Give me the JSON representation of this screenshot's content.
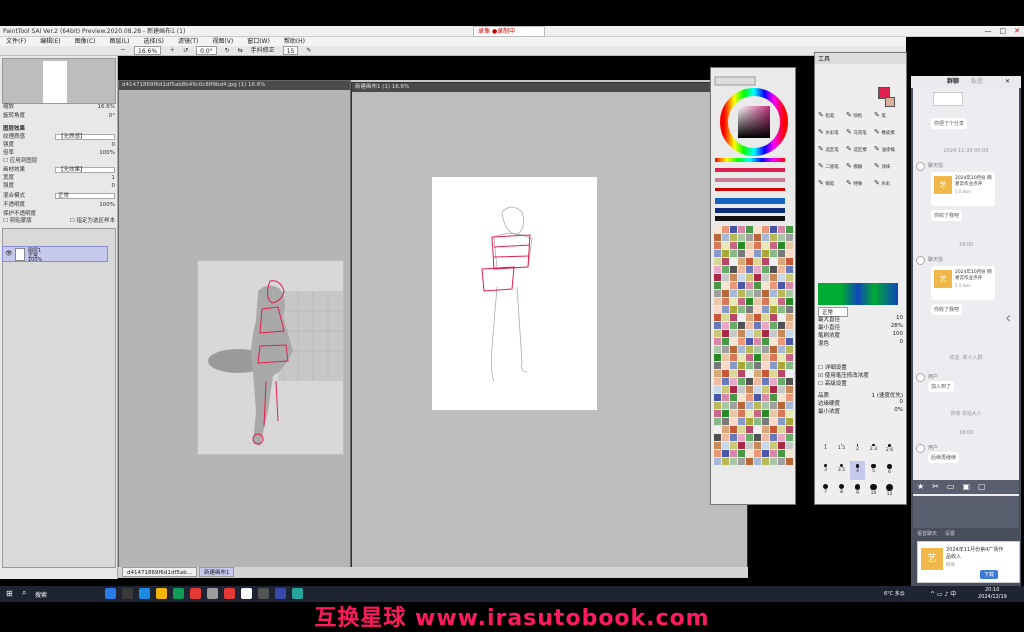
{
  "window": {
    "title": "PaintTool SAI Ver.2 (64bit) Preview.2020.08.28 - 新建画布1 (1)",
    "recording_label": "录像",
    "recording_time": "●录制中 00:09:12"
  },
  "menu": [
    "文件(F)",
    "编辑(E)",
    "图像(C)",
    "图层(L)",
    "选择(S)",
    "滤镜(T)",
    "视图(V)",
    "窗口(W)",
    "帮助(H)"
  ],
  "toolbar": {
    "zoom": "16.6%",
    "angle": "0.0°",
    "stabilizer_label": "手抖修正",
    "stabilizer": "15"
  },
  "left_panel": {
    "zoom_label": "缩放",
    "zoom_value": "16.6%",
    "angle_label": "旋转角度",
    "angle_value": "0°",
    "section_blend": "图层效果",
    "texture_label": "纹理质感",
    "texture_value": "【无质感】",
    "scale_label": "倍率",
    "scale_value": "100%",
    "strength_label": "强度",
    "strength_value": "0",
    "apply_checkbox": "应用到图层",
    "effect_label": "画材效果",
    "effect_value": "【无效果】",
    "width_label": "宽度",
    "width_value": "1",
    "strength2_label": "强度",
    "strength2_value": "0",
    "blend_label": "混合模式",
    "blend_value": "正常",
    "opacity_label": "不透明度",
    "opacity_value": "100%",
    "protect_label": "保护不透明度",
    "clip_label": "剪贴蒙版",
    "clip2_label": "指定为选区样本",
    "layer_name": "图层1",
    "layer_mode": "正常",
    "layer_opacity": "100%"
  },
  "documents": {
    "win1_title": "d41471869f6d1df5ab8b49c0c8ff9bd4.jpg (1) 16.6%",
    "win2_title": "新建画布1 (1) 16.6%",
    "tabs": [
      "d41471869f6d1df5ab...",
      "新建画布1"
    ]
  },
  "tool_panel": {
    "title": "工具",
    "brushes": [
      "铅笔",
      "喷枪",
      "笔",
      "水彩笔",
      "马克笔",
      "橡皮擦",
      "选区笔",
      "选区擦",
      "油漆桶",
      "二值笔",
      "模糊",
      "涂抹",
      "钢笔",
      "特殊",
      "水彩"
    ],
    "mode_label": "正常",
    "size_label": "最大直径",
    "size_value": "10",
    "min_label": "最小直径",
    "min_value": "28%",
    "density_label": "笔刷浓度",
    "density_value": "100",
    "blend_label": "混色",
    "blend_value": "0",
    "checkbox1": "详细设置",
    "checkbox2": "使用笔压修改浓度",
    "checkbox3": "高级设置",
    "quality_label": "品质",
    "quality_value": "1 (速度优先)",
    "edge_label": "边缘硬度",
    "edge_value": "0",
    "min_density": "最小浓度",
    "min_density_value": "0%",
    "brush_sizes": [
      "1",
      "1.5",
      "2",
      "2.3",
      "2.6",
      "3",
      "3.5",
      "4",
      "5",
      "6",
      "7",
      "8",
      "9",
      "10",
      "12"
    ]
  },
  "chat": {
    "tabs": [
      "群聊",
      "私信"
    ],
    "messages": [
      {
        "time": "",
        "sender": "",
        "text": "你把了个分享"
      },
      {
        "time": "2024-11-30 00:00",
        "sender": "聊天信",
        "card_title": "2024年10月份 网易云作业点评",
        "card_sub": "5.0.Ikon",
        "footer": "你收了我吧"
      },
      {
        "time": "18:00",
        "sender": "聊天信",
        "card_title": "2024年10月份 网易云作业点评",
        "card_sub": "5.0.Ikon",
        "footer": "你收了我吧"
      },
      {
        "time": "",
        "sender": "",
        "text": "欢迎, 新人入群"
      },
      {
        "time": "",
        "sender": "用户",
        "text": "加入到了"
      },
      {
        "time": "",
        "sender": "",
        "text": "你收  本站大人"
      },
      {
        "time": "18:00",
        "sender": "用户",
        "text": "后续再继续"
      }
    ],
    "bottom_label1": "语音聊天",
    "bottom_label2": "设置",
    "notif_title": "2024年11月份第4广场作品收入",
    "notif_sub": "网易",
    "notif_button": "下载"
  },
  "taskbar": {
    "search": "搜索",
    "weather": "6°C 多云",
    "time": "20:10",
    "date": "2024/12/19"
  },
  "watermark": "互换星球 www.irasutobook.com",
  "colors": {
    "accent": "#ff1a5e",
    "layer_selected": "#c6c8ee",
    "chat_bg": "#4a4f5e"
  }
}
